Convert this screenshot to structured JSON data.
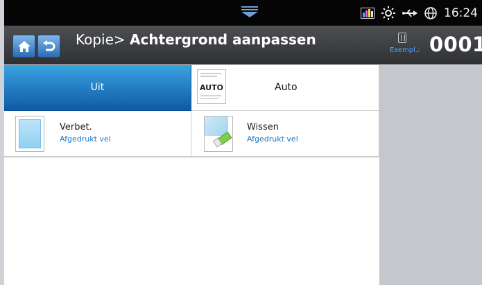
{
  "status": {
    "time": "16:24"
  },
  "header": {
    "breadcrumb_prefix": "Kopie>",
    "title": "Achtergrond aanpassen",
    "copies_label": "Exempl.:",
    "copies_value": "0001"
  },
  "options": [
    {
      "label": "Uit",
      "selected": true
    },
    {
      "label": "Auto",
      "icon_text": "AUTO",
      "selected": false
    },
    {
      "label": "Verbet.",
      "sub": "Afgedrukt vel",
      "selected": false
    },
    {
      "label": "Wissen",
      "sub": "Afgedrukt vel",
      "selected": false
    }
  ],
  "colors": {
    "accent": "#1f78c8",
    "selected_top": "#3aa2e0",
    "selected_bottom": "#0f5aa5",
    "link": "#1b77c8"
  }
}
